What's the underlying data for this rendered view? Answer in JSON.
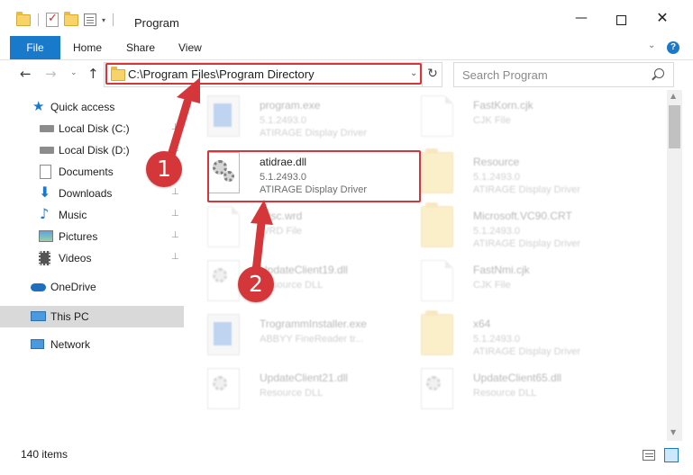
{
  "window": {
    "title": "Program",
    "minimize_glyph": "—",
    "close_glyph": "✕"
  },
  "ribbon": {
    "tabs": [
      "File",
      "Home",
      "Share",
      "View"
    ],
    "chevron": "⌄",
    "help": "?"
  },
  "address": {
    "path": "C:\\Program Files\\Program Directory",
    "dropdown_glyph": "⌄",
    "refresh_glyph": "↻",
    "back": "←",
    "forward": "→",
    "recent": "⌄",
    "up": "↑"
  },
  "search": {
    "placeholder": "Search Program"
  },
  "sidebar": {
    "items": [
      {
        "label": "Quick access",
        "icon": "star-icon",
        "pinned": false
      },
      {
        "label": "Local Disk (C:)",
        "icon": "drive-icon",
        "pinned": true
      },
      {
        "label": "Local Disk (D:)",
        "icon": "drive-icon",
        "pinned": true
      },
      {
        "label": "Documents",
        "icon": "documents-icon",
        "pinned": true
      },
      {
        "label": "Downloads",
        "icon": "download-icon",
        "pinned": true
      },
      {
        "label": "Music",
        "icon": "music-icon",
        "pinned": true
      },
      {
        "label": "Pictures",
        "icon": "pictures-icon",
        "pinned": true
      },
      {
        "label": "Videos",
        "icon": "videos-icon",
        "pinned": true
      },
      {
        "label": "OneDrive",
        "icon": "cloud-icon",
        "pinned": false
      },
      {
        "label": "This PC",
        "icon": "computer-icon",
        "pinned": false,
        "selected": true
      },
      {
        "label": "Network",
        "icon": "network-icon",
        "pinned": false
      }
    ],
    "pin_glyph": "📌"
  },
  "files": {
    "left": [
      {
        "name": "program.exe",
        "line2": "5.1.2493.0",
        "line3": "ATIRAGE Display Driver",
        "kind": "exe"
      },
      {
        "name": "atidrae.dll",
        "line2": "5.1.2493.0",
        "line3": "ATIRAGE Display Driver",
        "kind": "dll",
        "highlighted": true
      },
      {
        "name": "Misc.wrd",
        "line2": "WRD File",
        "line3": "",
        "kind": "doc"
      },
      {
        "name": "UpdateClient19.dll",
        "line2": "Resource DLL",
        "line3": "",
        "kind": "dll"
      },
      {
        "name": "TrogrammInstaller.exe",
        "line2": "ABBYY FineReader tr...",
        "line3": "",
        "kind": "exe"
      },
      {
        "name": "UpdateClient21.dll",
        "line2": "Resource DLL",
        "line3": "",
        "kind": "dll"
      }
    ],
    "right": [
      {
        "name": "FastKorn.cjk",
        "line2": "CJK File",
        "line3": "",
        "kind": "doc"
      },
      {
        "name": "Resource",
        "line2": "5.1.2493.0",
        "line3": "ATIRAGE Display Driver",
        "kind": "folder"
      },
      {
        "name": "Microsoft.VC90.CRT",
        "line2": "5.1.2493.0",
        "line3": "ATIRAGE Display Driver",
        "kind": "folder"
      },
      {
        "name": "FastNmi.cjk",
        "line2": "CJK File",
        "line3": "",
        "kind": "doc"
      },
      {
        "name": "x64",
        "line2": "5.1.2493.0",
        "line3": "ATIRAGE Display Driver",
        "kind": "folder"
      },
      {
        "name": "UpdateClient65.dll",
        "line2": "Resource DLL",
        "line3": "",
        "kind": "dll"
      }
    ]
  },
  "status": {
    "item_count": "140 items"
  },
  "annotations": {
    "step1": "1",
    "step2": "2",
    "color": "#d5363a"
  },
  "colors": {
    "accent": "#1979ca",
    "highlight": "#d5363a"
  }
}
